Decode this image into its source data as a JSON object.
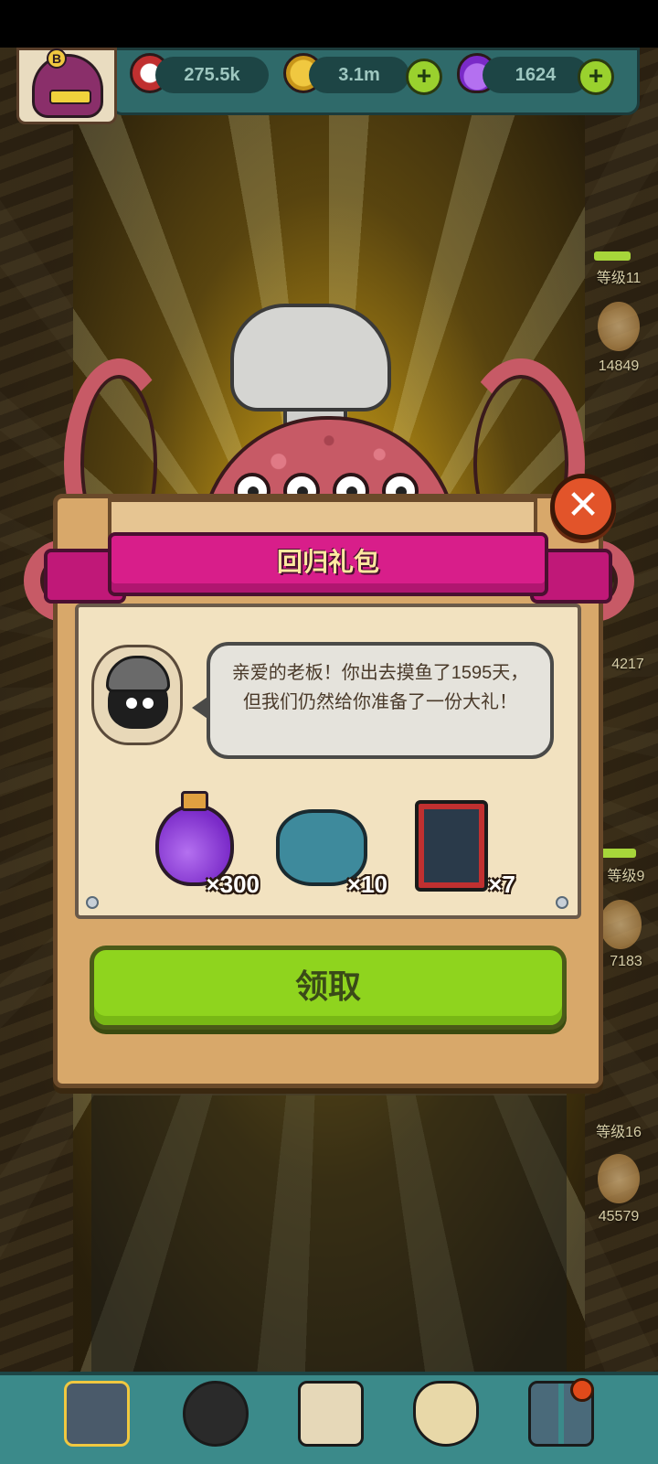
{
  "topbar": {
    "avatar_badge": "B",
    "resources": [
      {
        "name": "eyeball",
        "value": "275.5k"
      },
      {
        "name": "coin",
        "value": "3.1m"
      },
      {
        "name": "potion",
        "value": "1624"
      }
    ],
    "plus_label": "+"
  },
  "side": {
    "items": [
      {
        "label": "等级11"
      },
      {
        "label": "14849"
      },
      {
        "label": "4217"
      },
      {
        "label": "等级9"
      },
      {
        "label": "7183"
      },
      {
        "label": "等级16"
      },
      {
        "label": "45579"
      }
    ]
  },
  "dialog": {
    "title": "回归礼包",
    "close_label": "✕",
    "message": "亲爱的老板！你出去摸鱼了1595天，但我们仍然给你准备了一份大礼！",
    "rewards": [
      {
        "icon": "potion-icon",
        "qty": "×300"
      },
      {
        "icon": "engine-icon",
        "qty": "×10"
      },
      {
        "icon": "book-icon",
        "qty": "×7"
      }
    ],
    "claim_label": "领取"
  },
  "nav": {
    "items": [
      {
        "icon": "building-icon"
      },
      {
        "icon": "monster-icon"
      },
      {
        "icon": "book-icon"
      },
      {
        "icon": "money-bag-icon"
      },
      {
        "icon": "grid-icon"
      }
    ]
  },
  "colors": {
    "ribbon": "#d81e8a",
    "claim_button": "#8fd41e",
    "close_button": "#e2542a",
    "topbar": "#2f6a6a"
  }
}
